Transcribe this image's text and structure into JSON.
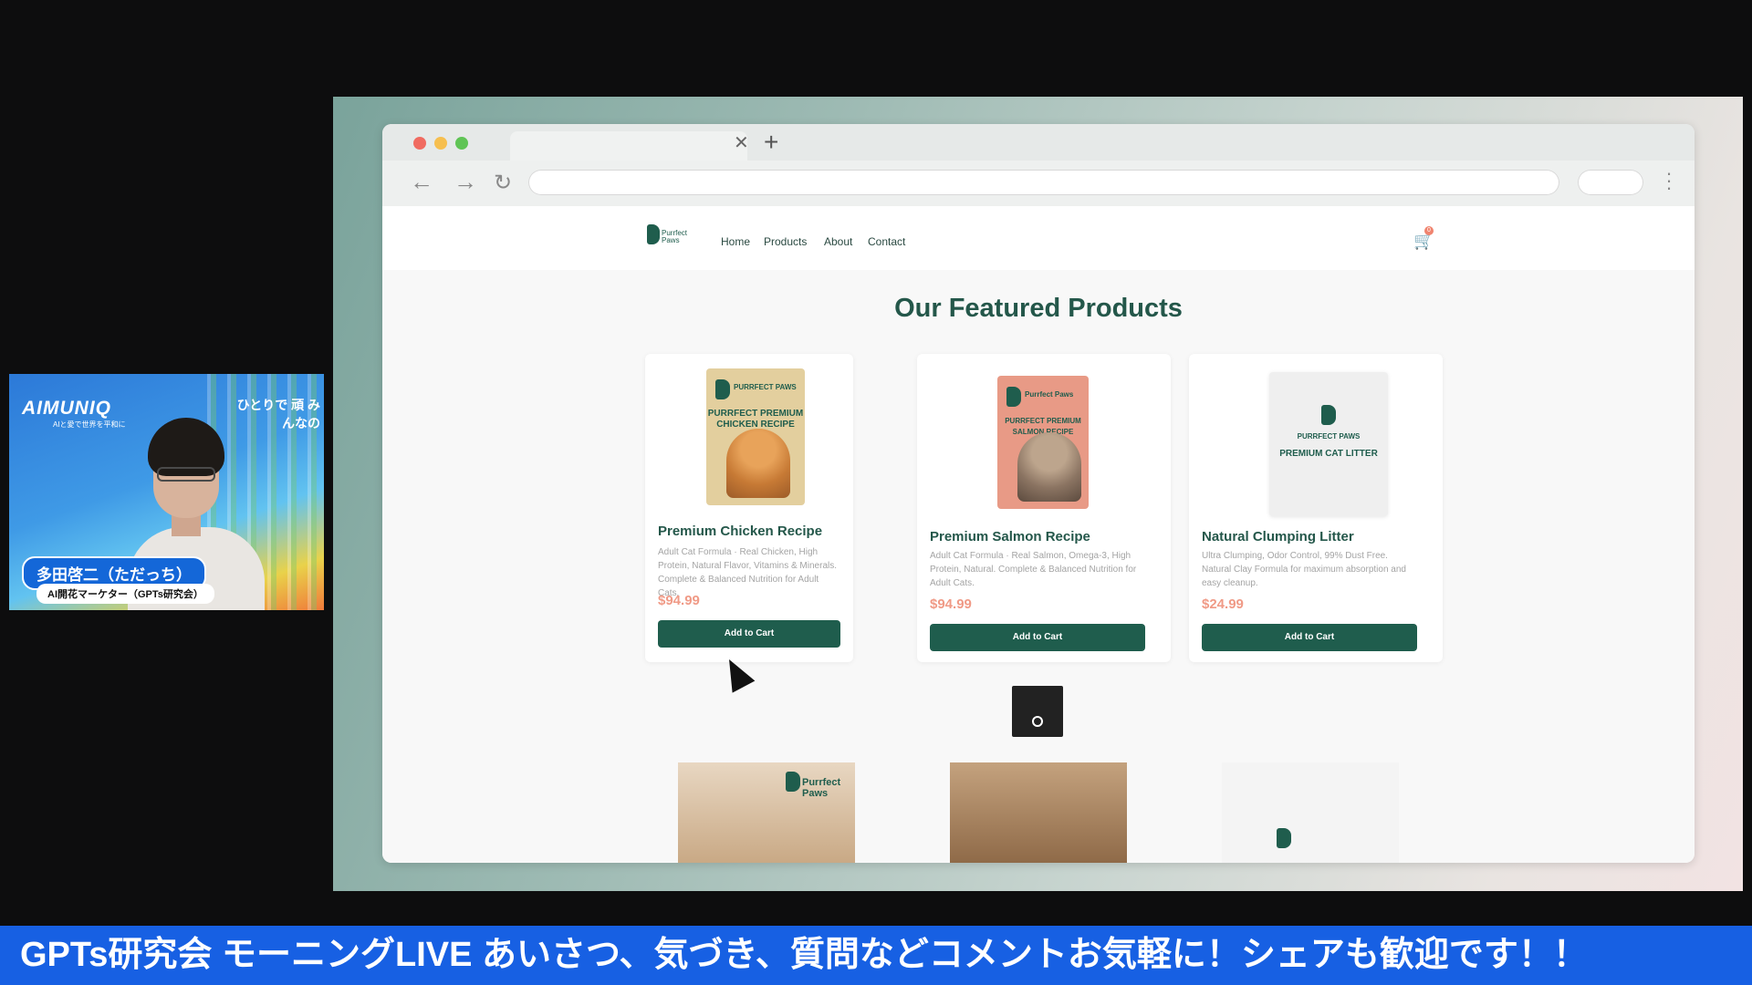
{
  "presenter": {
    "brand": "AIMUNIQ",
    "brand_sub": "AIと愛で世界を平和に",
    "tagline": "ひとりで 頑 みんなの",
    "name": "多田啓二（ただっち）",
    "role": "AI開花マーケター（GPTs研究会）"
  },
  "site": {
    "logo_text": "Purrfect Paws",
    "nav": [
      "Home",
      "Products",
      "About",
      "Contact"
    ],
    "cart_count": "0",
    "heading": "Our Featured Products",
    "products": [
      {
        "title": "Premium Chicken Recipe",
        "desc": "Adult Cat Formula · Real Chicken, High Protein, Natural Flavor, Vitamins & Minerals. Complete & Balanced Nutrition for Adult Cats.",
        "price": "$94.99",
        "button": "Add to Cart",
        "bag_brand": "PURRFECT PAWS",
        "bag_name": "PURRFECT PREMIUM CHICKEN RECIPE",
        "bag_color": "#e3cf9e"
      },
      {
        "title": "Premium Salmon Recipe",
        "desc": "Adult Cat Formula · Real Salmon, Omega-3, High Protein, Natural. Complete & Balanced Nutrition for Adult Cats.",
        "price": "$94.99",
        "button": "Add to Cart",
        "bag_brand": "Purrfect Paws",
        "bag_name": "PURRFECT PREMIUM SALMON RECIPE",
        "bag_color": "#e89a86"
      },
      {
        "title": "Natural Clumping Litter",
        "desc": "Ultra Clumping, Odor Control, 99% Dust Free. Natural Clay Formula for maximum absorption and easy cleanup.",
        "price": "$24.99",
        "button": "Add to Cart",
        "bag_brand": "PURRFECT PAWS",
        "bag_name": "PREMIUM CAT LITTER",
        "bag_color": "#efefef"
      }
    ],
    "thumb_brand": "Purrfect Paws"
  },
  "ticker": "GPTs研究会 モーニングLIVE あいさつ、気づき、質問などコメントお気軽に！シェアも歓迎です！！",
  "colors": {
    "brand_green": "#1f5d4d",
    "price_coral": "#f09a86",
    "ticker_blue": "#1760e3"
  }
}
